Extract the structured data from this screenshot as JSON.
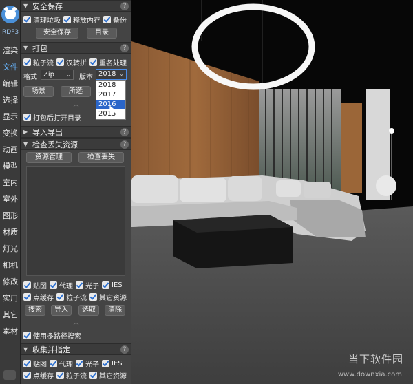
{
  "sidebar": {
    "brand": "RDF3",
    "items": [
      {
        "label": "渲染"
      },
      {
        "label": "文件"
      },
      {
        "label": "编辑"
      },
      {
        "label": "选择"
      },
      {
        "label": "显示"
      },
      {
        "label": "变换"
      },
      {
        "label": "动画"
      },
      {
        "label": "模型"
      },
      {
        "label": "室内"
      },
      {
        "label": "室外"
      },
      {
        "label": "图形"
      },
      {
        "label": "材质"
      },
      {
        "label": "灯光"
      },
      {
        "label": "相机"
      },
      {
        "label": "修改"
      },
      {
        "label": "实用"
      },
      {
        "label": "其它"
      },
      {
        "label": "素材"
      }
    ],
    "active_index": 1
  },
  "sections": {
    "safe_save": {
      "title": "安全保存",
      "checks": [
        {
          "label": "清理垃圾",
          "checked": true
        },
        {
          "label": "释放内存",
          "checked": true
        },
        {
          "label": "备份",
          "checked": true
        }
      ],
      "buttons": {
        "safe_save": "安全保存",
        "directory": "目录"
      }
    },
    "pack": {
      "title": "打包",
      "checks": [
        {
          "label": "粒子流",
          "checked": true
        },
        {
          "label": "汉转拼",
          "checked": true
        },
        {
          "label": "重名处理",
          "checked": true
        }
      ],
      "format_label": "格式",
      "format_value": "Zip",
      "version_label": "版本",
      "version_value": "2018",
      "version_options": [
        "2018",
        "2017",
        "2016",
        "2015"
      ],
      "version_highlight": "2016",
      "buttons": {
        "scene": "场景",
        "selected": "所选"
      },
      "open_dir_label": "打包后打开目录",
      "open_dir_checked": true
    },
    "import_export": {
      "title": "导入导出"
    },
    "missing": {
      "title": "检查丢失资源",
      "buttons": {
        "resource_manager": "资源管理",
        "check_missing": "检查丢失"
      },
      "checks_row1": [
        {
          "label": "贴图",
          "checked": true
        },
        {
          "label": "代理",
          "checked": true
        },
        {
          "label": "光子",
          "checked": true
        },
        {
          "label": "IES",
          "checked": true
        }
      ],
      "checks_row2": [
        {
          "label": "点缓存",
          "checked": true
        },
        {
          "label": "粒子流",
          "checked": true
        },
        {
          "label": "其它资源",
          "checked": true
        }
      ],
      "actions": {
        "search": "搜索",
        "import": "导入",
        "pick": "选取",
        "clear": "清除"
      },
      "multi_path_label": "使用多路径搜索",
      "multi_path_checked": true
    },
    "collect": {
      "title": "收集并指定",
      "checks_row1": [
        {
          "label": "贴图",
          "checked": true
        },
        {
          "label": "代理",
          "checked": true
        },
        {
          "label": "光子",
          "checked": true
        },
        {
          "label": "IES",
          "checked": true
        }
      ],
      "checks_row2": [
        {
          "label": "点缓存",
          "checked": true
        },
        {
          "label": "粒子流",
          "checked": true
        },
        {
          "label": "其它资源",
          "checked": true
        }
      ]
    }
  },
  "watermark": {
    "text": "当下软件园",
    "url": "www.downxia.com"
  }
}
